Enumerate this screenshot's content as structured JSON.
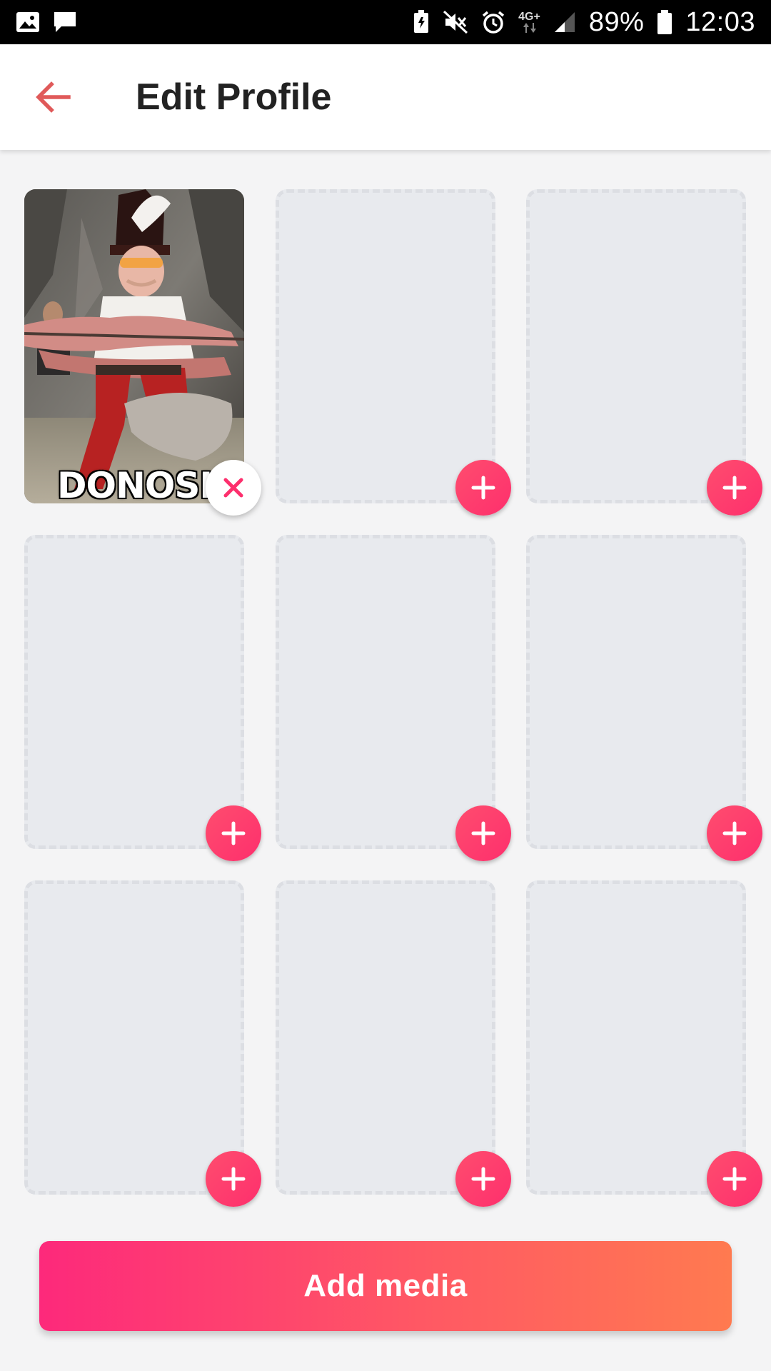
{
  "status_bar": {
    "network": "4G+",
    "battery": "89%",
    "time": "12:03"
  },
  "header": {
    "title": "Edit Profile",
    "back_icon": "arrow-left-icon"
  },
  "photo_grid": {
    "slots": [
      {
        "state": "filled",
        "caption": "DONOSIK",
        "action": "remove"
      },
      {
        "state": "empty",
        "action": "add"
      },
      {
        "state": "empty",
        "action": "add"
      },
      {
        "state": "empty",
        "action": "add"
      },
      {
        "state": "empty",
        "action": "add"
      },
      {
        "state": "empty",
        "action": "add"
      },
      {
        "state": "empty",
        "action": "add"
      },
      {
        "state": "empty",
        "action": "add"
      },
      {
        "state": "empty",
        "action": "add"
      }
    ]
  },
  "footer": {
    "add_media_label": "Add media"
  },
  "colors": {
    "accent": "#fd2f6d",
    "gradient_start": "#fd297b",
    "gradient_end": "#ff7a50",
    "back_arrow": "#e05a5a",
    "slot_bg": "#e8eaee"
  }
}
